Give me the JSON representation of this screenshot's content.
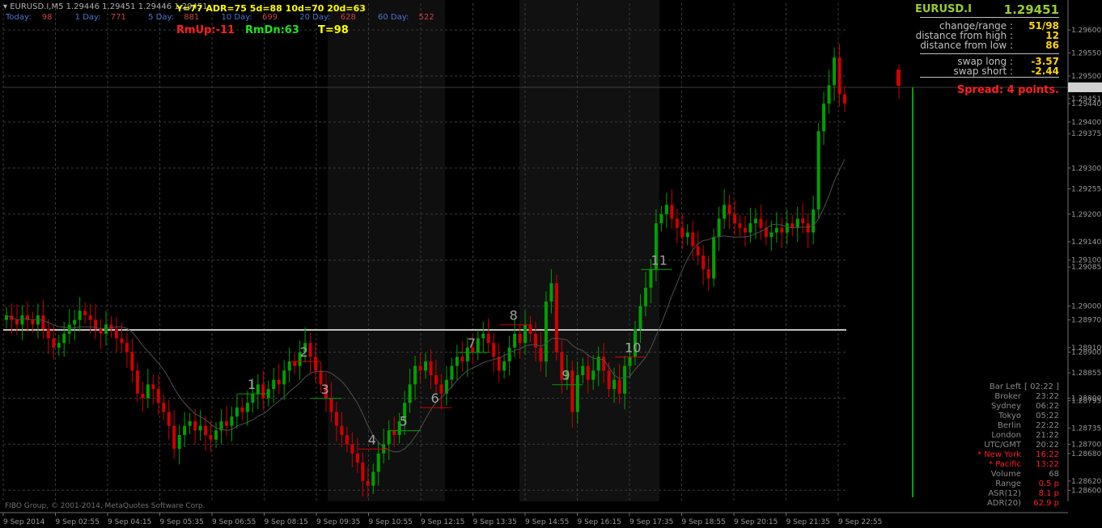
{
  "header": {
    "symbol_line": "EURUSD.I,M5  1.29446 1.29451 1.29446 1.29451",
    "stats": [
      {
        "label": "Today:",
        "value": "98"
      },
      {
        "label": "1 Day:",
        "value": "771"
      },
      {
        "label": "5 Day:",
        "value": "881"
      },
      {
        "label": "10 Day:",
        "value": "699"
      },
      {
        "label": "20 Day:",
        "value": "628"
      },
      {
        "label": "60 Day:",
        "value": "522"
      }
    ],
    "adr_line": "Y=77   ADR=75   5d=88   10d=70   20d=63",
    "rmup": "RmUp:-11",
    "rmdn": "RmDn:63",
    "t": "T=98"
  },
  "info_panel": {
    "symbol": "EURUSD.I",
    "price": "1.29451",
    "rows": [
      {
        "label": "change/range :",
        "value": "51/98"
      },
      {
        "label": "distance from high :",
        "value": "12"
      },
      {
        "label": "distance from low :",
        "value": "86"
      },
      {
        "label": "swap long :",
        "value": "-3.57"
      },
      {
        "label": "swap short :",
        "value": "-2.44"
      }
    ],
    "spread": "Spread: 4 points."
  },
  "bar_left": {
    "rows": [
      {
        "label": "Bar Left",
        "value": "[ 02:22 ]"
      },
      {
        "label": "Broker",
        "value": "23:22"
      },
      {
        "label": "Sydney",
        "value": "06:22"
      },
      {
        "label": "Tokyo",
        "value": "05:22"
      },
      {
        "label": "Berlin",
        "value": "22:22"
      },
      {
        "label": "London",
        "value": "21:22"
      },
      {
        "label": "UTC/GMT",
        "value": "20:22"
      },
      {
        "label": "* New York",
        "value": "16:22"
      },
      {
        "label": "* Pacific",
        "value": "13:22"
      },
      {
        "label": "Volume",
        "value": "68"
      },
      {
        "label": "Range",
        "value": "0.5 p"
      },
      {
        "label": "ASR(12)",
        "value": "8.1 p"
      },
      {
        "label": "ADR(20)",
        "value": "62.9 p"
      }
    ]
  },
  "copyright": "FIBO Group, © 2001-2014, MetaQuotes Software Corp.",
  "colors": {
    "up": "#00a000",
    "down": "#d00000",
    "grid": "#3a3a3a",
    "axis_text": "#9a9a9a"
  },
  "chart_data": {
    "type": "candlestick",
    "symbol": "EURUSD.I",
    "timeframe": "M5",
    "ylim": [
      1.2859,
      1.2963
    ],
    "price_axis_labels": [
      "1.29600",
      "1.29550",
      "1.29500",
      "1.29451",
      "1.29440",
      "1.29400",
      "1.29375",
      "1.29300",
      "1.29255",
      "1.29200",
      "1.29140",
      "1.29100",
      "1.29085",
      "1.29000",
      "1.28970",
      "1.28900",
      "1.28910",
      "1.28855",
      "1.28800",
      "1.28795",
      "1.28735",
      "1.28700",
      "1.28680",
      "1.28620",
      "1.28600"
    ],
    "time_axis_labels": [
      "9 Sep 2014",
      "9 Sep 02:55",
      "9 Sep 04:15",
      "9 Sep 05:35",
      "9 Sep 06:55",
      "9 Sep 08:15",
      "9 Sep 09:35",
      "9 Sep 10:55",
      "9 Sep 12:15",
      "9 Sep 13:35",
      "9 Sep 14:55",
      "9 Sep 16:15",
      "9 Sep 17:35",
      "9 Sep 18:55",
      "9 Sep 20:15",
      "9 Sep 21:35",
      "9 Sep 22:55"
    ],
    "horizontal_level": 1.2895,
    "current_price": 1.29451,
    "wave_labels": [
      {
        "text": "1",
        "price": 1.2882
      },
      {
        "text": "2",
        "price": 1.2889
      },
      {
        "text": "3",
        "price": 1.2881
      },
      {
        "text": "4",
        "price": 1.287
      },
      {
        "text": "5",
        "price": 1.2874
      },
      {
        "text": "6",
        "price": 1.2879
      },
      {
        "text": "7",
        "price": 1.2891
      },
      {
        "text": "8",
        "price": 1.2897
      },
      {
        "text": "9",
        "price": 1.2884
      },
      {
        "text": "10",
        "price": 1.289
      },
      {
        "text": "11",
        "price": 1.2909
      }
    ],
    "closes": [
      1.2898,
      1.2897,
      1.2896,
      1.2898,
      1.2897,
      1.2896,
      1.2898,
      1.2895,
      1.2893,
      1.2891,
      1.2892,
      1.2894,
      1.2896,
      1.2897,
      1.2899,
      1.2898,
      1.2897,
      1.2895,
      1.2894,
      1.2896,
      1.2895,
      1.2893,
      1.2892,
      1.289,
      1.2886,
      1.2881,
      1.288,
      1.2883,
      1.2882,
      1.2879,
      1.2877,
      1.2874,
      1.2869,
      1.2872,
      1.2874,
      1.2875,
      1.2873,
      1.2874,
      1.2872,
      1.2871,
      1.2873,
      1.2875,
      1.2874,
      1.2876,
      1.2878,
      1.2877,
      1.2879,
      1.2881,
      1.2883,
      1.288,
      1.2882,
      1.2884,
      1.2883,
      1.2886,
      1.2888,
      1.2887,
      1.289,
      1.2892,
      1.2889,
      1.2886,
      1.2883,
      1.288,
      1.2877,
      1.2874,
      1.2872,
      1.287,
      1.2868,
      1.2866,
      1.2862,
      1.2861,
      1.2864,
      1.2868,
      1.287,
      1.2873,
      1.2872,
      1.2875,
      1.2879,
      1.2883,
      1.2887,
      1.2886,
      1.2888,
      1.2885,
      1.2883,
      1.2881,
      1.2884,
      1.2887,
      1.2889,
      1.2888,
      1.2891,
      1.289,
      1.2893,
      1.2894,
      1.2892,
      1.2889,
      1.2886,
      1.2888,
      1.2891,
      1.2894,
      1.2892,
      1.2896,
      1.2894,
      1.2891,
      1.2888,
      1.2901,
      1.2905,
      1.289,
      1.2884,
      1.2886,
      1.2877,
      1.2885,
      1.2887,
      1.2884,
      1.2886,
      1.2889,
      1.2886,
      1.2882,
      1.2884,
      1.2881,
      1.2887,
      1.2889,
      1.2895,
      1.29,
      1.2904,
      1.2908,
      1.2918,
      1.292,
      1.2922,
      1.2919,
      1.2917,
      1.2915,
      1.2916,
      1.2913,
      1.2911,
      1.2908,
      1.2906,
      1.2915,
      1.2919,
      1.2922,
      1.292,
      1.2918,
      1.2917,
      1.2916,
      1.2918,
      1.2919,
      1.2917,
      1.2915,
      1.2916,
      1.2917,
      1.2916,
      1.2918,
      1.2917,
      1.2919,
      1.2918,
      1.2916,
      1.2921,
      1.2938,
      1.2944,
      1.2948,
      1.2954,
      1.2946,
      1.2944
    ]
  }
}
